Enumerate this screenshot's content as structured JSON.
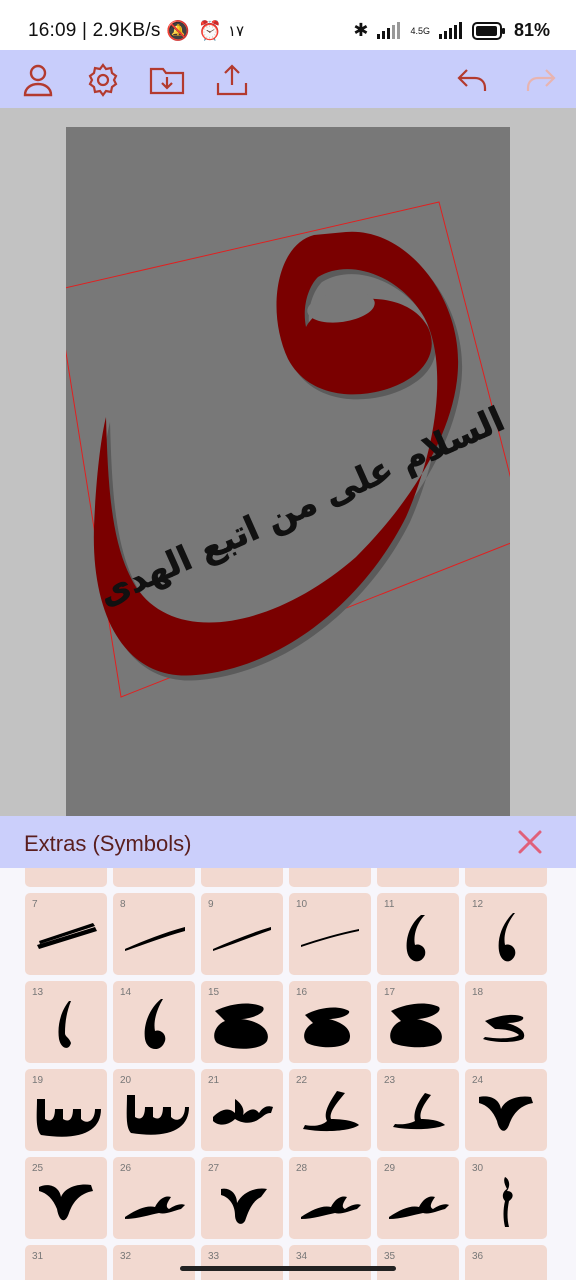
{
  "status_bar": {
    "time": "16:09 | 2.9KB/s",
    "extra_indicator": "١٧",
    "network_label": "4.5G",
    "battery": "81%"
  },
  "toolbar": {
    "buttons": [
      {
        "name": "profile",
        "icon": "user-icon"
      },
      {
        "name": "settings",
        "icon": "gear-icon"
      },
      {
        "name": "import",
        "icon": "folder-download-icon"
      },
      {
        "name": "share",
        "icon": "upload-icon"
      },
      {
        "name": "undo",
        "icon": "undo-icon"
      },
      {
        "name": "redo",
        "icon": "redo-icon",
        "disabled": true
      }
    ]
  },
  "canvas": {
    "arabic_text": "السلام على من اتبع الهدى",
    "letter_color": "#7a0000",
    "selection_color": "#e02020"
  },
  "extras_panel": {
    "title": "Extras (Symbols)",
    "close_icon": "close-icon",
    "symbols": [
      {
        "n": "7"
      },
      {
        "n": "8"
      },
      {
        "n": "9"
      },
      {
        "n": "10"
      },
      {
        "n": "11"
      },
      {
        "n": "12"
      },
      {
        "n": "13"
      },
      {
        "n": "14"
      },
      {
        "n": "15"
      },
      {
        "n": "16"
      },
      {
        "n": "17"
      },
      {
        "n": "18"
      },
      {
        "n": "19"
      },
      {
        "n": "20"
      },
      {
        "n": "21"
      },
      {
        "n": "22"
      },
      {
        "n": "23"
      },
      {
        "n": "24"
      },
      {
        "n": "25"
      },
      {
        "n": "26"
      },
      {
        "n": "27"
      },
      {
        "n": "28"
      },
      {
        "n": "29"
      },
      {
        "n": "30"
      },
      {
        "n": "31"
      },
      {
        "n": "32"
      },
      {
        "n": "33"
      },
      {
        "n": "34"
      },
      {
        "n": "35"
      },
      {
        "n": "36"
      }
    ]
  },
  "colors": {
    "toolbar_bg": "#c8cdfb",
    "icon_color": "#b33a2e",
    "cell_bg": "#f2d9d0",
    "close_color": "#e0607a"
  }
}
